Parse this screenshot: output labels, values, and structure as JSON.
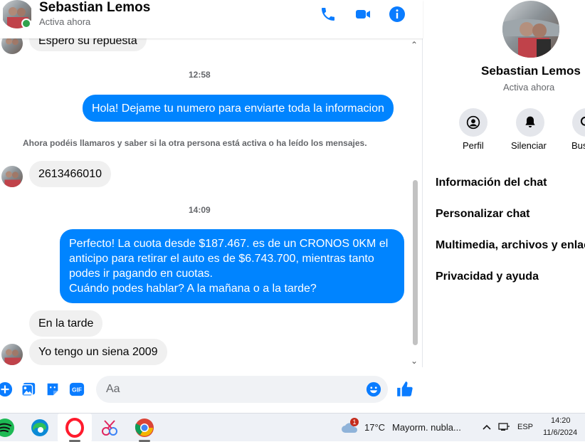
{
  "contact": {
    "name": "Sebastian Lemos",
    "status": "Activa ahora"
  },
  "messages": {
    "partial": "Espero su repuesta",
    "time1": "12:58",
    "out1": "Hola! Dejame tu numero para enviarte toda la informacion",
    "notice": "Ahora podéis llamaros y saber si la otra persona está activa o ha leído los mensajes.",
    "in1": "2613466010",
    "time2": "14:09",
    "out2": [
      "Perfecto! La cuota desde $187.467. es de un CRONOS 0KM el",
      "anticipo para retirar el auto es de $6.743.700, mientras tanto",
      "podes ir pagando en cuotas.",
      "Cuándo podes hablar? A la mañana o a la tarde?"
    ],
    "in2": "En la tarde",
    "in3": "Yo tengo un siena 2009"
  },
  "composer": {
    "placeholder": "Aa"
  },
  "panel": {
    "name": "Sebastian Lemos",
    "status": "Activa ahora",
    "actions": [
      "Perfil",
      "Silenciar",
      "Bus"
    ],
    "items": [
      "Información del chat",
      "Personalizar chat",
      "Multimedia, archivos y enlac",
      "Privacidad y ayuda"
    ]
  },
  "taskbar": {
    "weather_temp": "17°C",
    "weather_text": "Mayorm. nubla...",
    "weather_badge": "1",
    "lang": "ESP",
    "time": "14:20",
    "date": "11/6/2024"
  },
  "colors": {
    "accent": "#0084ff",
    "online": "#31a24c",
    "incoming": "#f0f0f0"
  },
  "icons": [
    "phone-icon",
    "video-icon",
    "info-icon",
    "plus-icon",
    "image-icon",
    "sticker-icon",
    "gif-icon",
    "emoji-icon",
    "like-icon",
    "profile-icon",
    "bell-icon",
    "search-icon"
  ]
}
